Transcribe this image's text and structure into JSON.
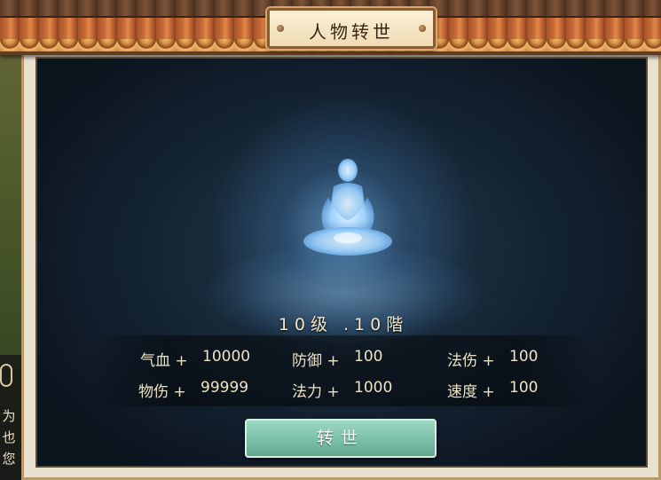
{
  "window": {
    "title": "人物转世"
  },
  "chat": {
    "lines": [
      "为",
      "也",
      "您"
    ]
  },
  "rebirth": {
    "level_text": "10级 .10階",
    "stats": [
      {
        "label": "气血 +",
        "value": "10000"
      },
      {
        "label": "防御 +",
        "value": "100"
      },
      {
        "label": "法伤 +",
        "value": "100"
      },
      {
        "label": "物伤 +",
        "value": "99999"
      },
      {
        "label": "法力 +",
        "value": "1000"
      },
      {
        "label": "速度 +",
        "value": "100"
      }
    ],
    "button_label": "转世"
  },
  "colors": {
    "button": "#7cc2aa",
    "glow": "#9fd4ff",
    "roof": "#c86a36"
  }
}
